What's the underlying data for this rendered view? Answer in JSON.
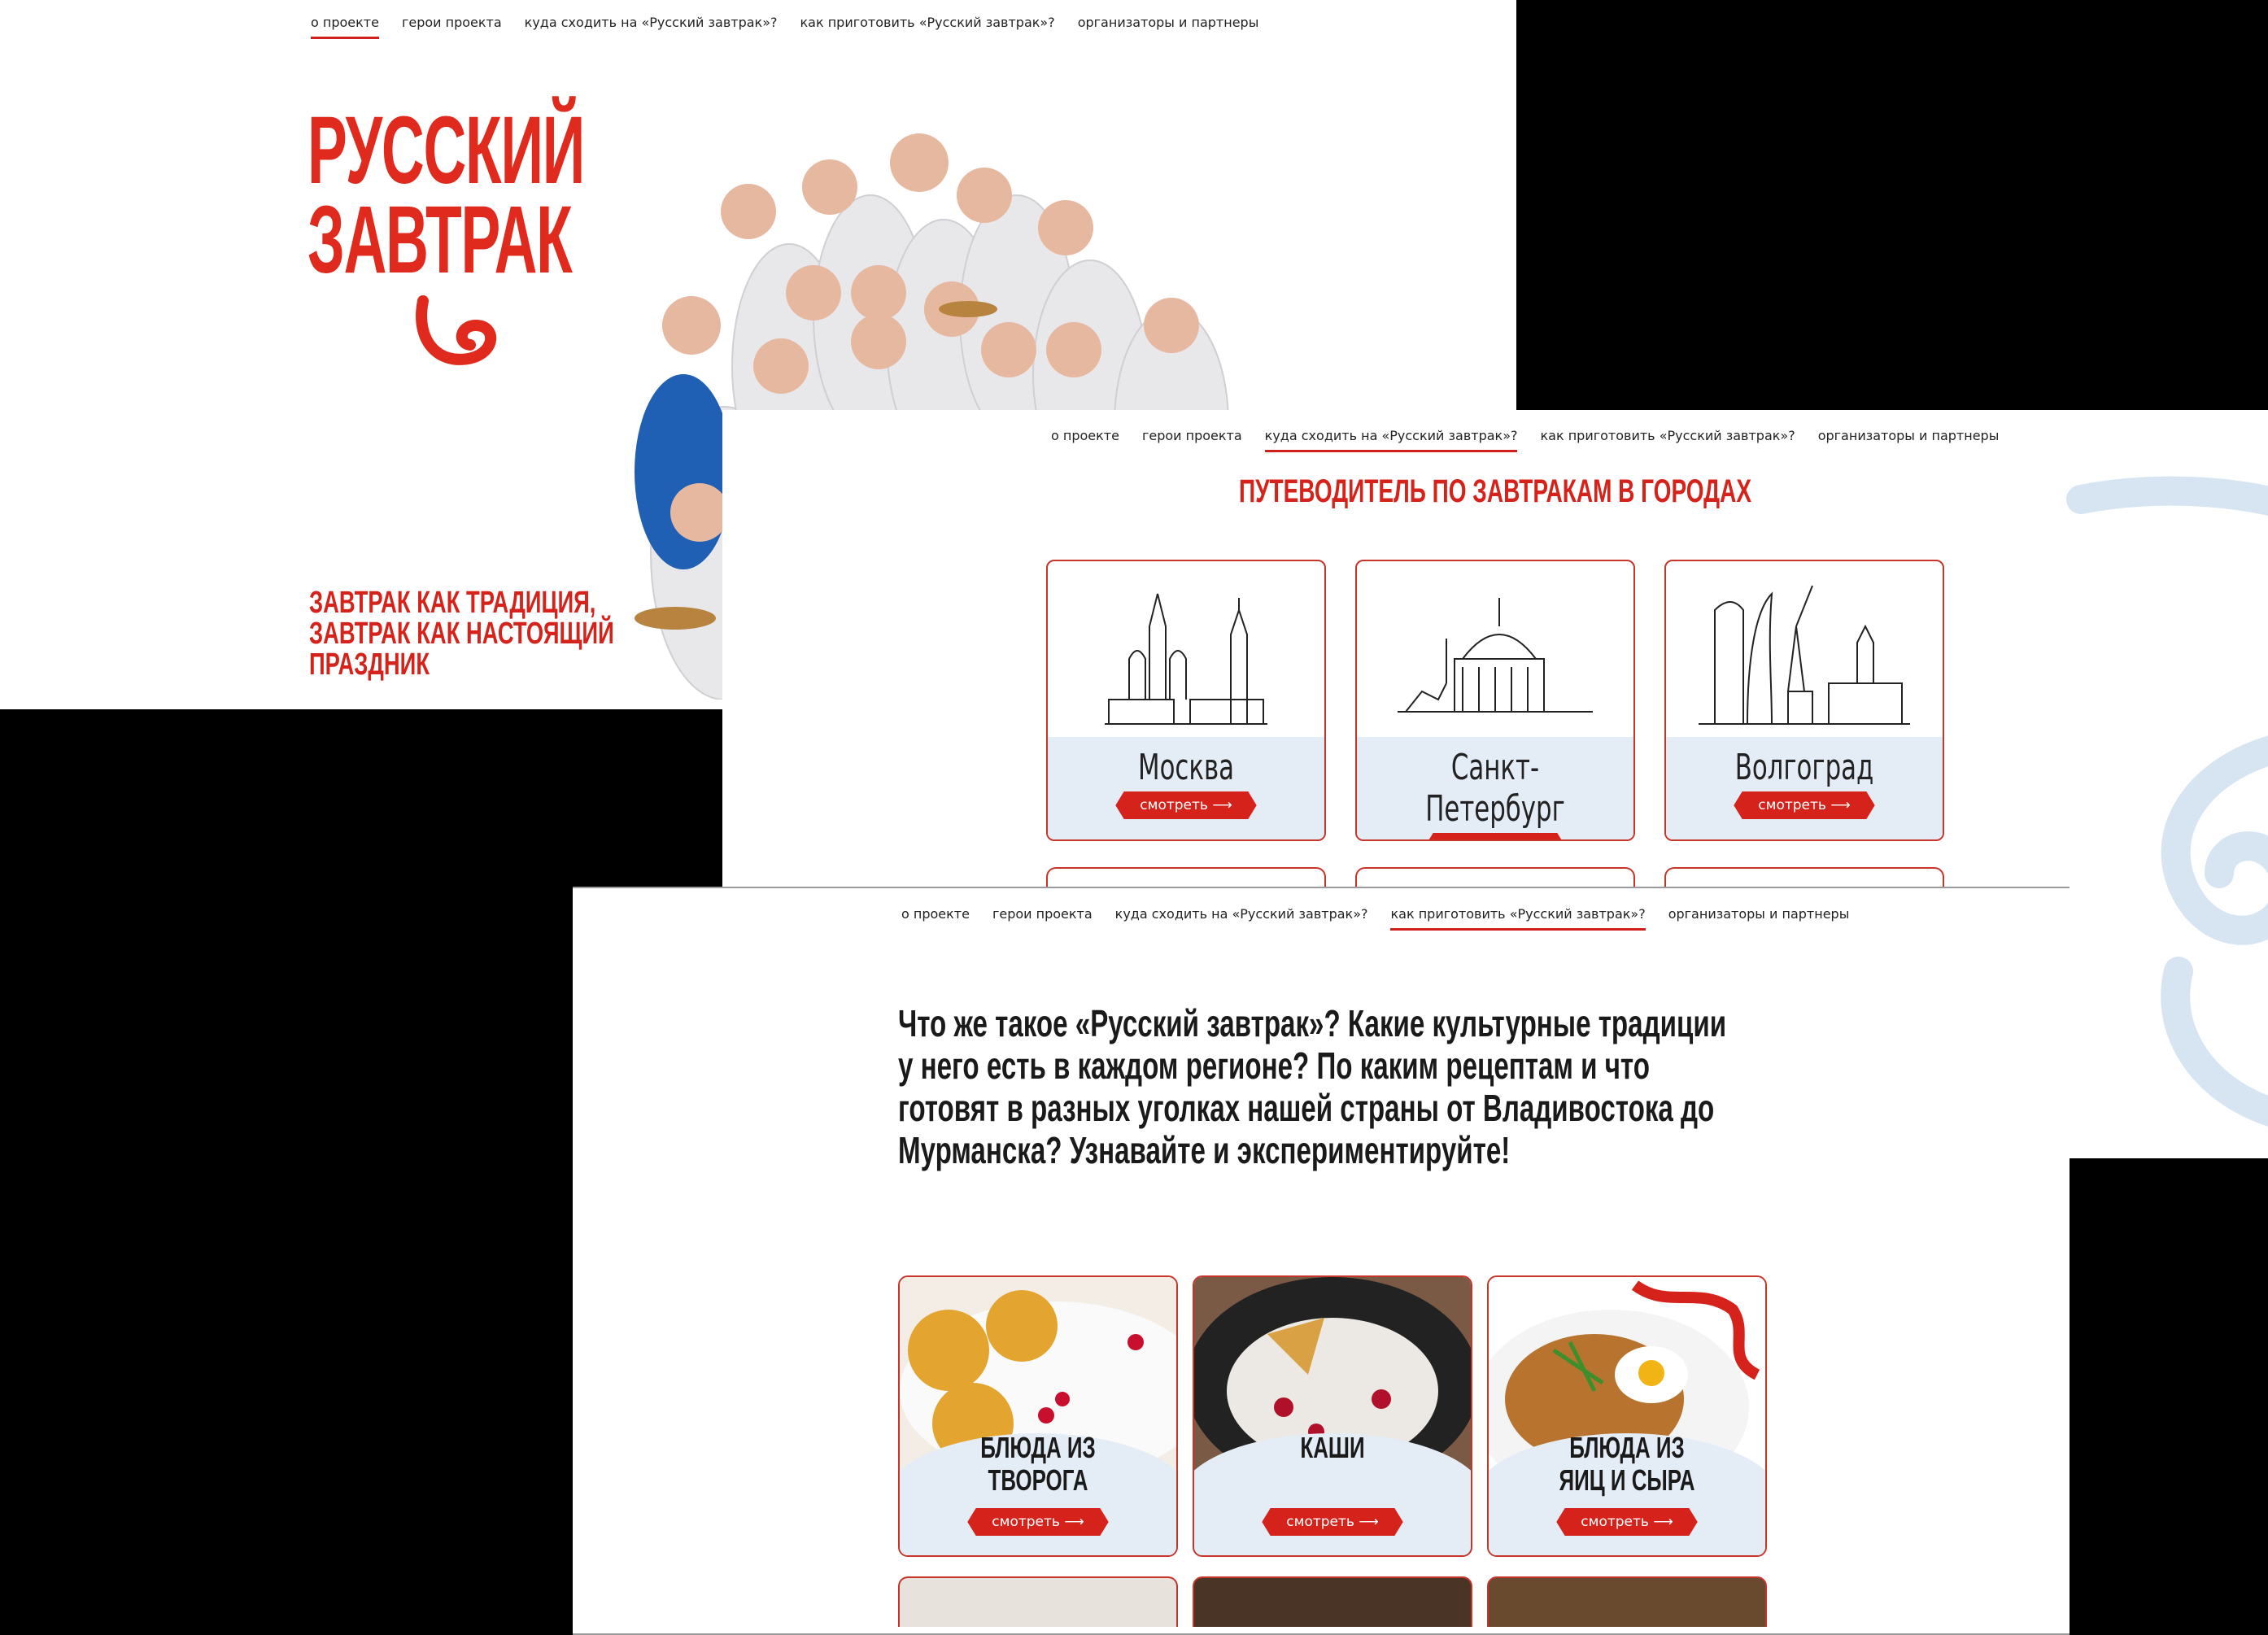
{
  "nav": {
    "items": [
      "о проекте",
      "герои проекта",
      "куда сходить на «Русский завтрак»?",
      "как приготовить «Русский завтрак»?",
      "организаторы и партнеры"
    ]
  },
  "hero": {
    "logo_line1": "РУССКИЙ",
    "logo_line2": "ЗАВТРАК",
    "tagline_line1": "ЗАВТРАК КАК ТРАДИЦИЯ,",
    "tagline_line2": "ЗАВТРАК КАК НАСТОЯЩИЙ",
    "tagline_line3": "ПРАЗДНИК"
  },
  "guide": {
    "title": "ПУТЕВОДИТЕЛЬ ПО ЗАВТРАКАМ В ГОРОДАХ",
    "cities": [
      {
        "name": "Москва",
        "button": "смотреть ⟶"
      },
      {
        "name": "Санкт-Петербург",
        "button": "смотреть ⟶"
      },
      {
        "name": "Волгоград",
        "button": "смотреть ⟶"
      }
    ]
  },
  "recipes": {
    "intro": "Что же такое «Русский завтрак»? Какие культурные традиции у него есть в каждом регионе? По каким рецептам и что готовят в разных уголках нашей страны от Владивостока до Мурманска? Узнавайте и экспериментируйте!",
    "dishes": [
      {
        "title_line1": "БЛЮДА ИЗ",
        "title_line2": "ТВОРОГА",
        "button": "смотреть ⟶"
      },
      {
        "title_line1": "",
        "title_line2": "КАШИ",
        "button": "смотреть ⟶"
      },
      {
        "title_line1": "БЛЮДА ИЗ",
        "title_line2": "ЯИЦ И СЫРА",
        "button": "смотреть ⟶"
      }
    ]
  },
  "colors": {
    "accent": "#d5231c",
    "card_bg": "#e4edf6",
    "ornament": "#d7e5f3"
  }
}
